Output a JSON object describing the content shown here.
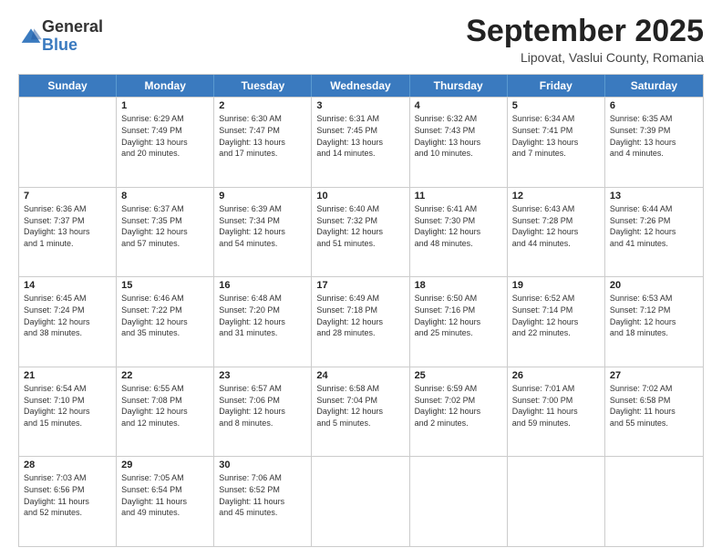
{
  "header": {
    "logo": {
      "line1": "General",
      "line2": "Blue"
    },
    "month": "September 2025",
    "location": "Lipovat, Vaslui County, Romania"
  },
  "weekdays": [
    "Sunday",
    "Monday",
    "Tuesday",
    "Wednesday",
    "Thursday",
    "Friday",
    "Saturday"
  ],
  "weeks": [
    [
      {
        "day": "",
        "info": ""
      },
      {
        "day": "1",
        "info": "Sunrise: 6:29 AM\nSunset: 7:49 PM\nDaylight: 13 hours\nand 20 minutes."
      },
      {
        "day": "2",
        "info": "Sunrise: 6:30 AM\nSunset: 7:47 PM\nDaylight: 13 hours\nand 17 minutes."
      },
      {
        "day": "3",
        "info": "Sunrise: 6:31 AM\nSunset: 7:45 PM\nDaylight: 13 hours\nand 14 minutes."
      },
      {
        "day": "4",
        "info": "Sunrise: 6:32 AM\nSunset: 7:43 PM\nDaylight: 13 hours\nand 10 minutes."
      },
      {
        "day": "5",
        "info": "Sunrise: 6:34 AM\nSunset: 7:41 PM\nDaylight: 13 hours\nand 7 minutes."
      },
      {
        "day": "6",
        "info": "Sunrise: 6:35 AM\nSunset: 7:39 PM\nDaylight: 13 hours\nand 4 minutes."
      }
    ],
    [
      {
        "day": "7",
        "info": "Sunrise: 6:36 AM\nSunset: 7:37 PM\nDaylight: 13 hours\nand 1 minute."
      },
      {
        "day": "8",
        "info": "Sunrise: 6:37 AM\nSunset: 7:35 PM\nDaylight: 12 hours\nand 57 minutes."
      },
      {
        "day": "9",
        "info": "Sunrise: 6:39 AM\nSunset: 7:34 PM\nDaylight: 12 hours\nand 54 minutes."
      },
      {
        "day": "10",
        "info": "Sunrise: 6:40 AM\nSunset: 7:32 PM\nDaylight: 12 hours\nand 51 minutes."
      },
      {
        "day": "11",
        "info": "Sunrise: 6:41 AM\nSunset: 7:30 PM\nDaylight: 12 hours\nand 48 minutes."
      },
      {
        "day": "12",
        "info": "Sunrise: 6:43 AM\nSunset: 7:28 PM\nDaylight: 12 hours\nand 44 minutes."
      },
      {
        "day": "13",
        "info": "Sunrise: 6:44 AM\nSunset: 7:26 PM\nDaylight: 12 hours\nand 41 minutes."
      }
    ],
    [
      {
        "day": "14",
        "info": "Sunrise: 6:45 AM\nSunset: 7:24 PM\nDaylight: 12 hours\nand 38 minutes."
      },
      {
        "day": "15",
        "info": "Sunrise: 6:46 AM\nSunset: 7:22 PM\nDaylight: 12 hours\nand 35 minutes."
      },
      {
        "day": "16",
        "info": "Sunrise: 6:48 AM\nSunset: 7:20 PM\nDaylight: 12 hours\nand 31 minutes."
      },
      {
        "day": "17",
        "info": "Sunrise: 6:49 AM\nSunset: 7:18 PM\nDaylight: 12 hours\nand 28 minutes."
      },
      {
        "day": "18",
        "info": "Sunrise: 6:50 AM\nSunset: 7:16 PM\nDaylight: 12 hours\nand 25 minutes."
      },
      {
        "day": "19",
        "info": "Sunrise: 6:52 AM\nSunset: 7:14 PM\nDaylight: 12 hours\nand 22 minutes."
      },
      {
        "day": "20",
        "info": "Sunrise: 6:53 AM\nSunset: 7:12 PM\nDaylight: 12 hours\nand 18 minutes."
      }
    ],
    [
      {
        "day": "21",
        "info": "Sunrise: 6:54 AM\nSunset: 7:10 PM\nDaylight: 12 hours\nand 15 minutes."
      },
      {
        "day": "22",
        "info": "Sunrise: 6:55 AM\nSunset: 7:08 PM\nDaylight: 12 hours\nand 12 minutes."
      },
      {
        "day": "23",
        "info": "Sunrise: 6:57 AM\nSunset: 7:06 PM\nDaylight: 12 hours\nand 8 minutes."
      },
      {
        "day": "24",
        "info": "Sunrise: 6:58 AM\nSunset: 7:04 PM\nDaylight: 12 hours\nand 5 minutes."
      },
      {
        "day": "25",
        "info": "Sunrise: 6:59 AM\nSunset: 7:02 PM\nDaylight: 12 hours\nand 2 minutes."
      },
      {
        "day": "26",
        "info": "Sunrise: 7:01 AM\nSunset: 7:00 PM\nDaylight: 11 hours\nand 59 minutes."
      },
      {
        "day": "27",
        "info": "Sunrise: 7:02 AM\nSunset: 6:58 PM\nDaylight: 11 hours\nand 55 minutes."
      }
    ],
    [
      {
        "day": "28",
        "info": "Sunrise: 7:03 AM\nSunset: 6:56 PM\nDaylight: 11 hours\nand 52 minutes."
      },
      {
        "day": "29",
        "info": "Sunrise: 7:05 AM\nSunset: 6:54 PM\nDaylight: 11 hours\nand 49 minutes."
      },
      {
        "day": "30",
        "info": "Sunrise: 7:06 AM\nSunset: 6:52 PM\nDaylight: 11 hours\nand 45 minutes."
      },
      {
        "day": "",
        "info": ""
      },
      {
        "day": "",
        "info": ""
      },
      {
        "day": "",
        "info": ""
      },
      {
        "day": "",
        "info": ""
      }
    ]
  ]
}
